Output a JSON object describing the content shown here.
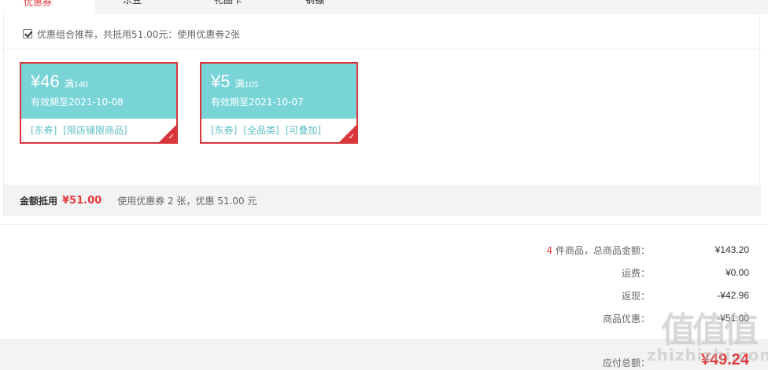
{
  "tabs": [
    {
      "label": "优惠券"
    },
    {
      "label": "东豆"
    },
    {
      "label": "礼品卡"
    },
    {
      "label": "钢镚"
    }
  ],
  "combo": {
    "text": "优惠组合推荐，共抵用51.00元：使用优惠券2张",
    "checked": true
  },
  "coupons": [
    {
      "price": "¥46",
      "condition": "满140",
      "valid": "有效期至2021-10-08",
      "tags": [
        "[东券]",
        "[限店铺限商品]"
      ]
    },
    {
      "price": "¥5",
      "condition": "满105",
      "valid": "有效期至2021-10-07",
      "tags": [
        "[东券]",
        "[全品类]",
        "[可叠加]"
      ]
    }
  ],
  "summary": {
    "label": "金额抵用",
    "amount": "¥51.00",
    "desc": "使用优惠券 2 张，优惠 51.00 元"
  },
  "totals": {
    "count": "4",
    "count_label": " 件商品，总商品金额：",
    "goods_amount": "¥143.20",
    "shipping_label": "运费：",
    "shipping": "¥0.00",
    "rebate_label": "返现：",
    "rebate": "-¥42.96",
    "discount_label": "商品优惠：",
    "discount": "-¥51.00"
  },
  "pay": {
    "label": "应付总额：",
    "amount": "¥49.24"
  },
  "watermark": {
    "line1": "值值值",
    "line2": "zhizhizhi.com"
  },
  "colors": {
    "accent": "#e4393c",
    "coupon_bg": "#79d4d8",
    "coupon_border": "#d8363b",
    "tag": "#5bbfc5"
  }
}
